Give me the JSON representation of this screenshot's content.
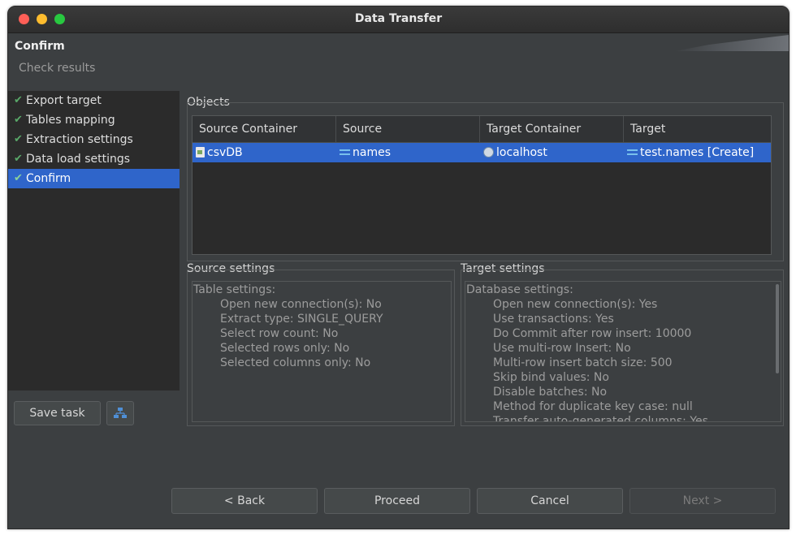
{
  "window": {
    "title": "Data Transfer"
  },
  "header": {
    "title": "Confirm",
    "subtitle": "Check results"
  },
  "nav": {
    "items": [
      {
        "label": "Export target",
        "selected": false
      },
      {
        "label": "Tables mapping",
        "selected": false
      },
      {
        "label": "Extraction settings",
        "selected": false
      },
      {
        "label": "Data load settings",
        "selected": false
      },
      {
        "label": "Confirm",
        "selected": true
      }
    ]
  },
  "objects": {
    "label": "Objects",
    "columns": [
      "Source Container",
      "Source",
      "Target Container",
      "Target"
    ],
    "rows": [
      {
        "source_container": "csvDB",
        "source": "names",
        "target_container": "localhost",
        "target": "test.names [Create]"
      }
    ]
  },
  "source_settings": {
    "label": "Source settings",
    "heading": "Table settings:",
    "lines": [
      "Open new connection(s): No",
      "Extract type: SINGLE_QUERY",
      "Select row count: No",
      "Selected rows only: No",
      "Selected columns only: No"
    ]
  },
  "target_settings": {
    "label": "Target settings",
    "heading": "Database settings:",
    "lines": [
      "Open new connection(s): Yes",
      "Use transactions: Yes",
      "Do Commit after row insert: 10000",
      "Use multi-row Insert: No",
      "Multi-row insert batch size: 500",
      "Skip bind values: No",
      "Disable batches: No",
      "Method for duplicate key case: null",
      "Transfer auto-generated columns: Yes"
    ]
  },
  "buttons": {
    "save_task": "Save task",
    "back": "< Back",
    "proceed": "Proceed",
    "cancel": "Cancel",
    "next": "Next >"
  },
  "colors": {
    "selection": "#2f65ca",
    "check": "#59a869"
  }
}
